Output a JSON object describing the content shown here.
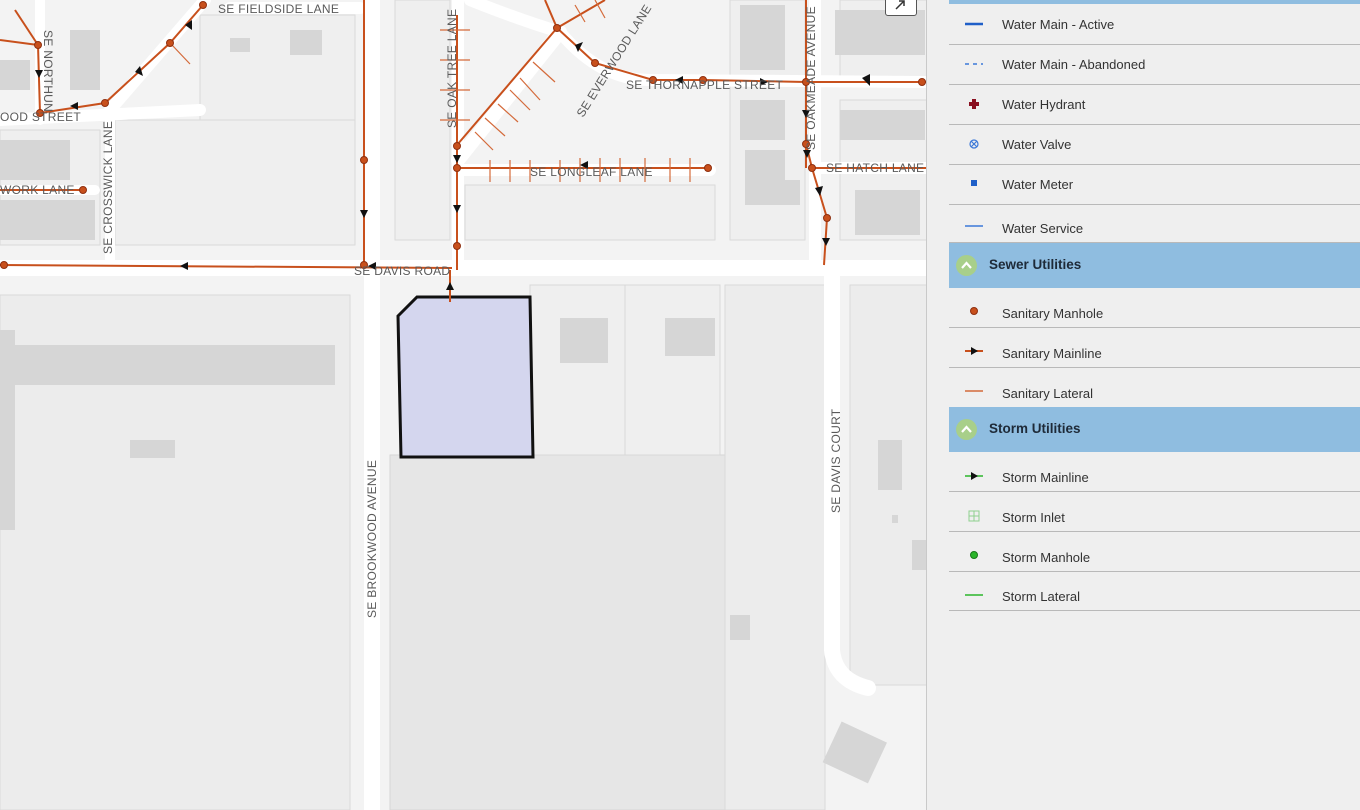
{
  "map": {
    "streets": {
      "fieldside": "SE FIELDSIDE LANE",
      "northun": "SE NORTHUN",
      "woodstreet": "OOD STREET",
      "workl": "WORK LANE",
      "crosswick": "SE CROSSWICK LANE",
      "oaktree": "SE OAK TREE LANE",
      "everwood": "SE EVERWOOD LANE",
      "thornapple": "SE THORNAPPLE STREET",
      "oakmeade": "SE OAKMEADE AVENUE",
      "longleaf": "SE LONGLEAF LANE",
      "hatch": "SE HATCH LANE",
      "davisroad": "SE DAVIS ROAD",
      "brookwood": "SE BROOKWOOD AVENUE",
      "daviscourt": "SE DAVIS COURT"
    },
    "colors": {
      "sanitary": "#c8501c",
      "parcel_fill": "#d4d6ee",
      "parcel_outline": "#111111",
      "road": "#ffffff",
      "building": "#d8d8d8"
    },
    "icons": {
      "expand": "expand-arrow-icon"
    }
  },
  "legend": {
    "water_items": [
      {
        "label": "Water Main - Active",
        "icon": "water-main-active-icon"
      },
      {
        "label": "Water Main - Abandoned",
        "icon": "water-main-abandoned-icon"
      },
      {
        "label": "Water Hydrant",
        "icon": "water-hydrant-icon"
      },
      {
        "label": "Water Valve",
        "icon": "water-valve-icon"
      },
      {
        "label": "Water Meter",
        "icon": "water-meter-icon"
      },
      {
        "label": "Water Service",
        "icon": "water-service-icon"
      }
    ],
    "sewer": {
      "title": "Sewer Utilities",
      "items": [
        {
          "label": "Sanitary Manhole",
          "icon": "sanitary-manhole-icon"
        },
        {
          "label": "Sanitary Mainline",
          "icon": "sanitary-mainline-icon"
        },
        {
          "label": "Sanitary Lateral",
          "icon": "sanitary-lateral-icon"
        }
      ]
    },
    "storm": {
      "title": "Storm Utilities",
      "items": [
        {
          "label": "Storm Mainline",
          "icon": "storm-mainline-icon"
        },
        {
          "label": "Storm Inlet",
          "icon": "storm-inlet-icon"
        },
        {
          "label": "Storm Manhole",
          "icon": "storm-manhole-icon"
        },
        {
          "label": "Storm Lateral",
          "icon": "storm-lateral-icon"
        }
      ]
    },
    "colors": {
      "section_header": "#8fbde0",
      "collapse_button": "#a8cf8a",
      "water_blue": "#1f5fc8",
      "hydrant_red": "#8a1020",
      "sanitary_orange": "#c8501c",
      "storm_green": "#2bb52b"
    }
  }
}
